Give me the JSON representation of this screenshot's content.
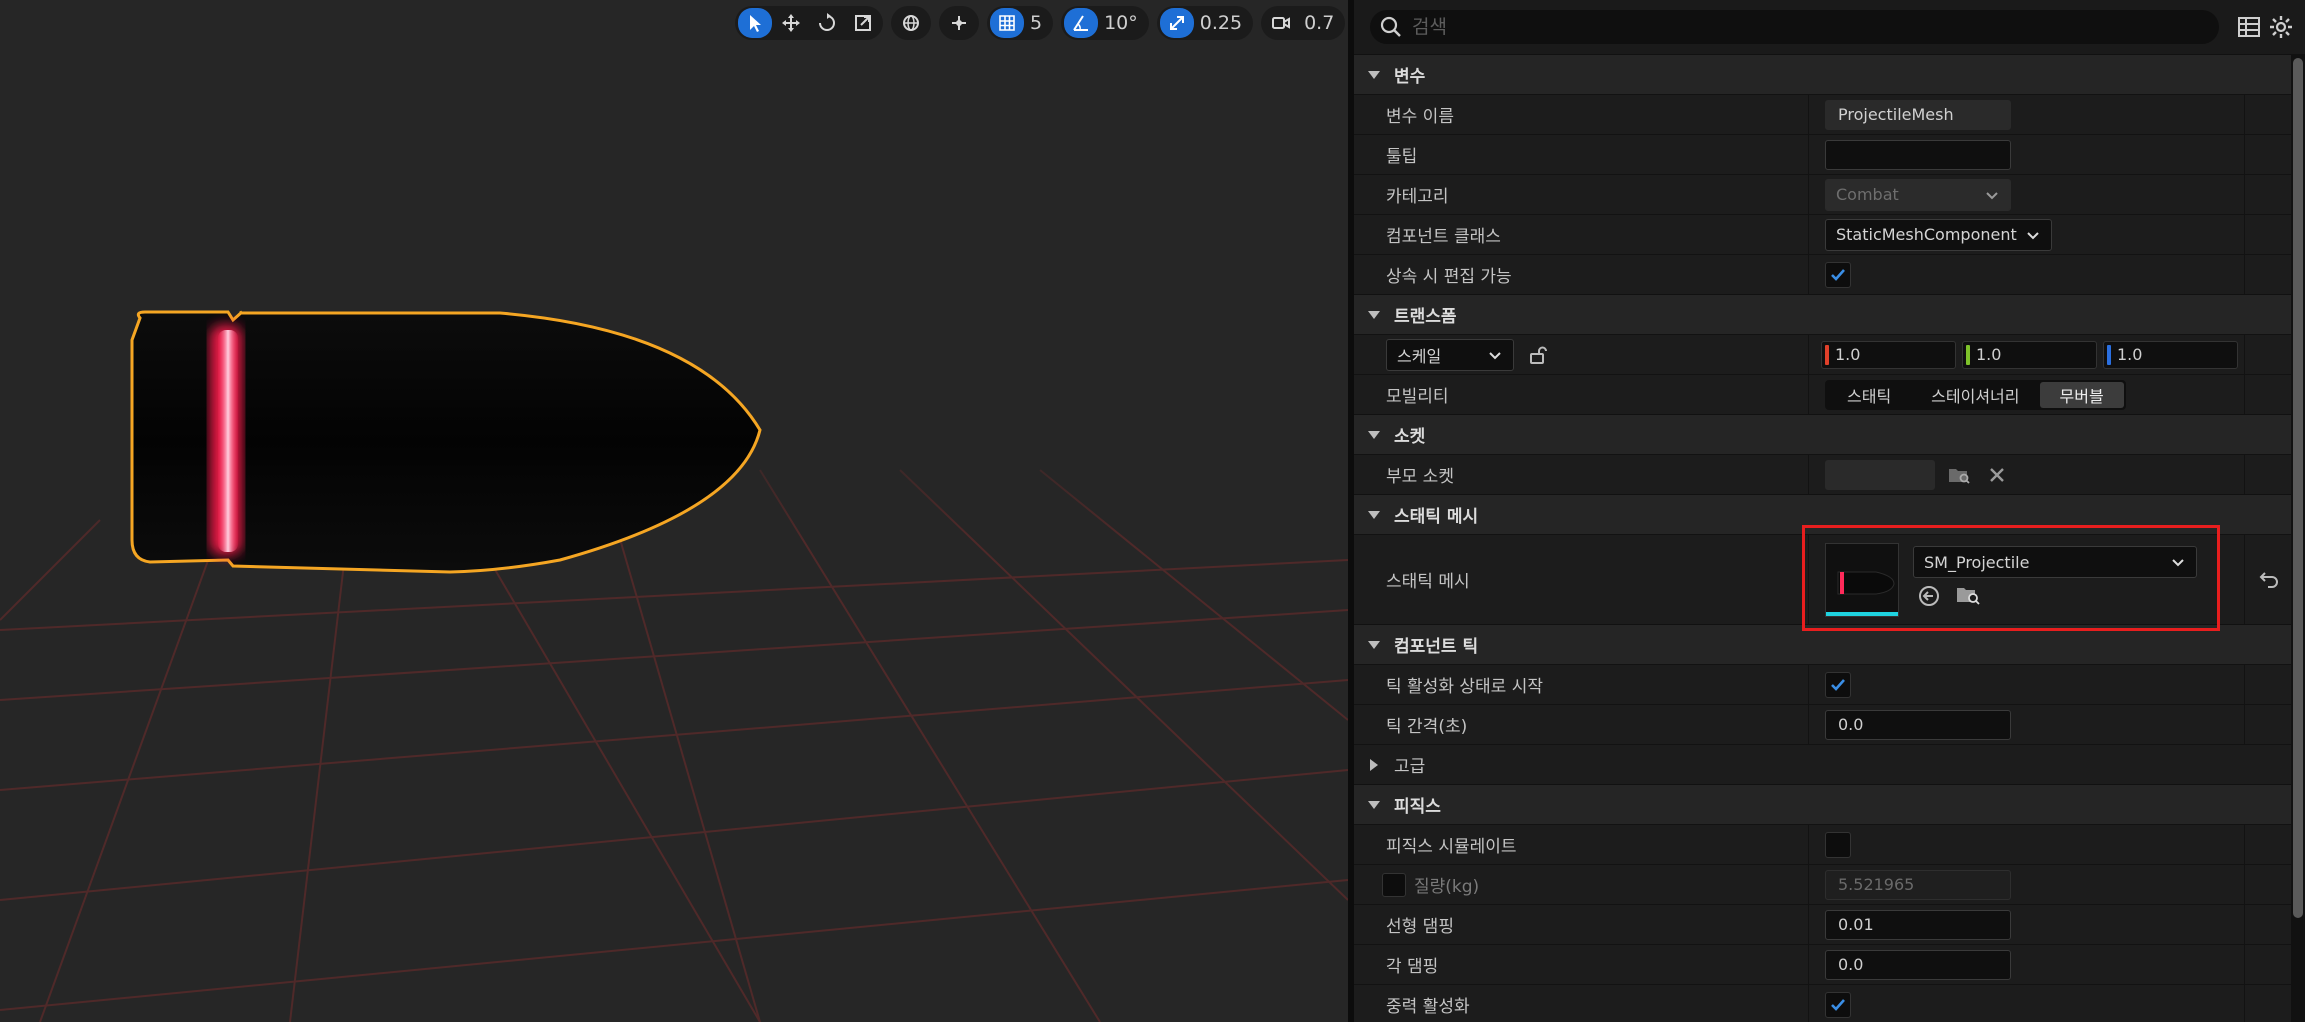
{
  "viewport": {
    "toolbar": {
      "grid_value": "5",
      "angle_value": "10°",
      "scale_value": "0.25",
      "camera_value": "0.7"
    }
  },
  "details": {
    "search": {
      "placeholder": "검색"
    },
    "sections": {
      "variables": {
        "title": "변수",
        "var_name_label": "변수 이름",
        "var_name_value": "ProjectileMesh",
        "tooltip_label": "툴팁",
        "tooltip_value": "",
        "category_label": "카테고리",
        "category_value": "Combat",
        "component_class_label": "컴포넌트 클래스",
        "component_class_value": "StaticMeshComponent",
        "editable_label": "상속 시 편집 가능",
        "editable_checked": true
      },
      "transform": {
        "title": "트랜스폼",
        "scale_label": "스케일",
        "scale_x": "1.0",
        "scale_y": "1.0",
        "scale_z": "1.0",
        "mobility_label": "모빌리티",
        "mobility_options": [
          "스태틱",
          "스테이셔너리",
          "무버블"
        ],
        "mobility_selected": "무버블"
      },
      "sockets": {
        "title": "소켓",
        "parent_socket_label": "부모 소켓",
        "parent_socket_value": ""
      },
      "static_mesh": {
        "title": "스태틱 메시",
        "mesh_label": "스태틱 메시",
        "mesh_value": "SM_Projectile"
      },
      "component_tick": {
        "title": "컴포넌트 틱",
        "start_enabled_label": "틱 활성화 상태로 시작",
        "start_enabled_checked": true,
        "tick_interval_label": "틱 간격(초)",
        "tick_interval_value": "0.0"
      },
      "advanced": {
        "title": "고급"
      },
      "physics": {
        "title": "피직스",
        "simulate_label": "피직스 시뮬레이트",
        "simulate_checked": false,
        "mass_label": "질량(kg)",
        "mass_value": "5.521965",
        "linear_damping_label": "선형 댐핑",
        "linear_damping_value": "0.01",
        "angular_damping_label": "각 댐핑",
        "angular_damping_value": "0.0",
        "gravity_label": "중력 활성화",
        "gravity_checked": true
      }
    }
  },
  "colors": {
    "accent_blue": "#1e6fd6",
    "selection_outline": "#f5a623",
    "highlight_red": "#e81e1e",
    "axis_x": "#e0402a",
    "axis_y": "#7ec22a",
    "axis_z": "#2a6fe0"
  }
}
